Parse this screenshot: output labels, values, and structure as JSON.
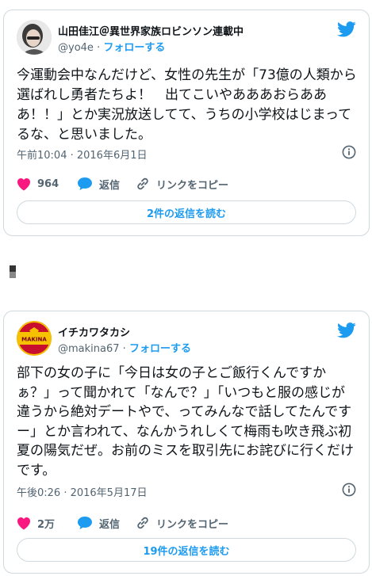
{
  "tweets": [
    {
      "name": "山田佳江＠異世界家族ロビンソン連載中",
      "handle": "@yo4e",
      "separator": "·",
      "follow": "フォローする",
      "text": "今運動会中なんだけど、女性の先生が「73億の人類から選ばれし勇者たちよ！　出てこいやあああおらあああ！！」とか実況放送してて、うちの小学校はじまってるな、と思いました。",
      "timestamp": "午前10:04 · 2016年6月1日",
      "likes": "964",
      "reply_label": "返信",
      "copy_label": "リンクをコピー",
      "replies_button": "2件の返信を読む",
      "avatar_icon": "user-photo-avatar"
    },
    {
      "name": "イチカワタカシ",
      "handle": "@makina67",
      "separator": "·",
      "follow": "フォローする",
      "text": "部下の女の子に「今日は女の子とご飯行くんですかぁ？」って聞かれて「なんで？」「いつもと服の感じが違うから絶対デートやで、ってみんなで話してたんですー」とか言われて、なんかうれしくて梅雨も吹き飛ぶ初夏の陽気だぜ。お前のミスを取引先にお詫びに行くだけです。",
      "timestamp": "午後0:26 · 2016年5月17日",
      "likes": "2万",
      "reply_label": "返信",
      "copy_label": "リンクをコピー",
      "replies_button": "19件の返信を読む",
      "avatar_text": "MAKINA"
    }
  ],
  "colors": {
    "accent": "#1d9bf0",
    "like": "#f91880",
    "muted": "#536471",
    "border": "#cfd9de"
  }
}
